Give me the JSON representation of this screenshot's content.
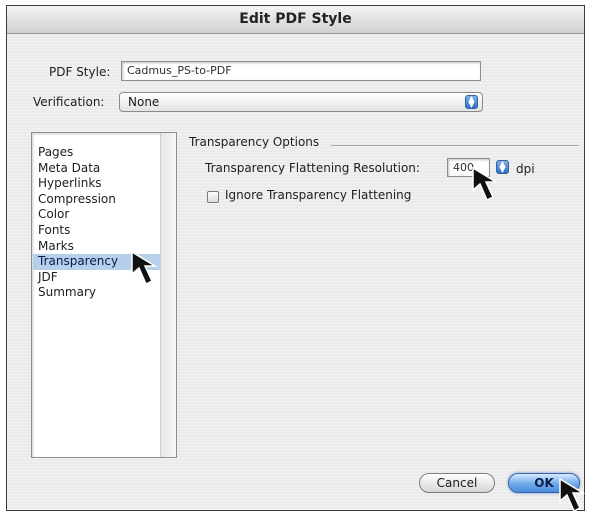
{
  "window": {
    "title": "Edit PDF Style"
  },
  "pdf_style": {
    "label": "PDF Style:",
    "value": "Cadmus_PS-to-PDF"
  },
  "verification": {
    "label": "Verification:",
    "value": "None"
  },
  "sidebar": {
    "items": [
      {
        "label": "Pages",
        "selected": false
      },
      {
        "label": "Meta Data",
        "selected": false
      },
      {
        "label": "Hyperlinks",
        "selected": false
      },
      {
        "label": "Compression",
        "selected": false
      },
      {
        "label": "Color",
        "selected": false
      },
      {
        "label": "Fonts",
        "selected": false
      },
      {
        "label": "Marks",
        "selected": false
      },
      {
        "label": "Transparency",
        "selected": true
      },
      {
        "label": "JDF",
        "selected": false
      },
      {
        "label": "Summary",
        "selected": false
      }
    ]
  },
  "transparency": {
    "group_title": "Transparency Options",
    "resolution_label": "Transparency Flattening Resolution:",
    "resolution_value": "400",
    "resolution_unit": "dpi",
    "ignore_label": "Ignore Transparency Flattening",
    "ignore_checked": false
  },
  "buttons": {
    "cancel": "Cancel",
    "ok": "OK"
  },
  "icons": {
    "popup_arrows": "up-down-arrows-icon",
    "stepper": "stepper-arrows-icon",
    "pointer": "mouse-pointer-icon"
  },
  "colors": {
    "selection": "#b6d0ec",
    "default_button": "#6fa9ea"
  }
}
